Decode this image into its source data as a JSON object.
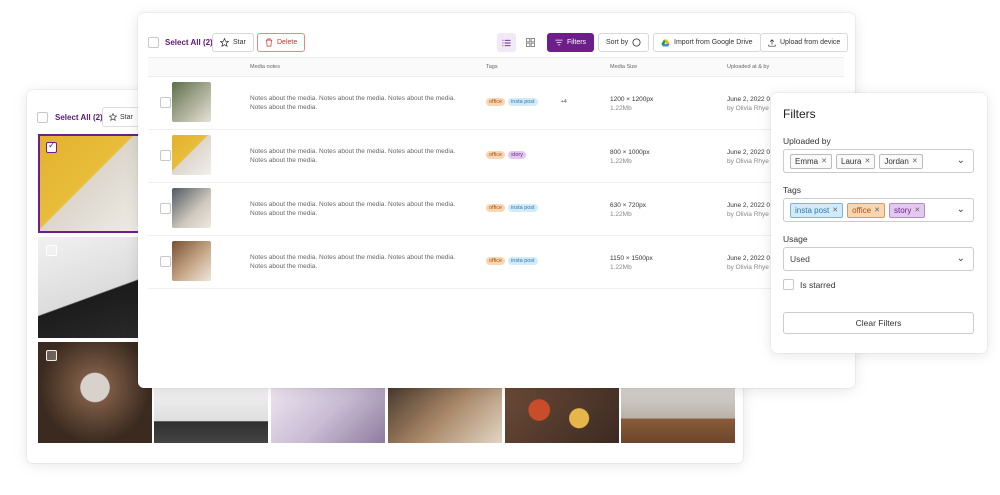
{
  "gallery": {
    "select_all_label": "Select All (2)",
    "star_label": "Star",
    "photos": [
      {
        "selected": true
      },
      {
        "selected": false
      },
      {
        "selected": false
      }
    ]
  },
  "toolbar": {
    "select_all_label": "Select All (2)",
    "star_label": "Star",
    "delete_label": "Delete",
    "filters_label": "Filters",
    "sort_label": "Sort by",
    "import_label": "Import from Google Drive",
    "upload_label": "Upload from device"
  },
  "table": {
    "columns": [
      "Media notes",
      "Tags",
      "Media Size",
      "Uploaded at & by"
    ],
    "rows": [
      {
        "notes": "Notes about the media. Notes about the media. Notes about the media. Notes about the media.",
        "tags": [
          "office",
          "insta post"
        ],
        "more": "+4",
        "size": "1200 × 1200px",
        "filesize": "1.22Mb",
        "date": "June 2, 2022 0",
        "by": "by Olivia Rhye"
      },
      {
        "notes": "Notes about the media. Notes about the media. Notes about the media. Notes about the media.",
        "tags": [
          "office",
          "story"
        ],
        "more": "",
        "size": "800 × 1000px",
        "filesize": "1.22Mb",
        "date": "June 2, 2022 0",
        "by": "by Olivia Rhye"
      },
      {
        "notes": "Notes about the media. Notes about the media. Notes about the media. Notes about the media.",
        "tags": [
          "office",
          "insta post"
        ],
        "more": "",
        "size": "630 × 720px",
        "filesize": "1.22Mb",
        "date": "June 2, 2022 0",
        "by": "by Olivia Rhye"
      },
      {
        "notes": "Notes about the media. Notes about the media. Notes about the media. Notes about the media.",
        "tags": [
          "office",
          "insta post"
        ],
        "more": "",
        "size": "1150 × 1500px",
        "filesize": "1.22Mb",
        "date": "June 2, 2022 0",
        "by": "by Olivia Rhye"
      }
    ]
  },
  "filters": {
    "title": "Filters",
    "uploaded_by_label": "Uploaded by",
    "uploaded_by": [
      "Emma",
      "Laura",
      "Jordan"
    ],
    "tags_label": "Tags",
    "tags": [
      "insta post",
      "office",
      "story"
    ],
    "usage_label": "Usage",
    "usage_value": "Used",
    "is_starred_label": "Is starred",
    "clear_label": "Clear Filters"
  },
  "colors": {
    "accent": "#6d1e8a",
    "tag_office": "#f9d6b0",
    "tag_insta": "#d3ebf9",
    "tag_story": "#e3c9ef",
    "delete": "#c0392b"
  },
  "icons": {
    "star": "star-icon",
    "delete": "trash-icon",
    "list": "list-view-icon",
    "grid": "grid-view-icon",
    "filter": "filter-icon",
    "sort": "sort-circle-icon",
    "drive": "google-drive-icon",
    "upload": "upload-icon",
    "chevron": "chevron-down-icon",
    "remove": "close-icon"
  }
}
